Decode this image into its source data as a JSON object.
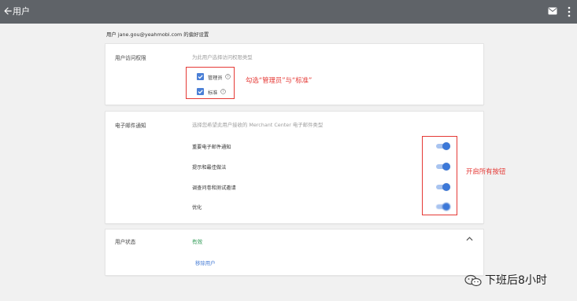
{
  "app_bar": {
    "title": "用户",
    "back_icon": "arrow-back-icon",
    "mail_icon": "mail-icon",
    "more_icon": "more-vert-icon",
    "background": "#5f6368"
  },
  "page_title": "用户 jane.gou@yeahmobi.com 的偏好设置",
  "access": {
    "label": "用户访问权限",
    "description": "为此用户选择访问权限类型",
    "options": [
      {
        "label": "管理员",
        "checked": true
      },
      {
        "label": "标准",
        "checked": true
      }
    ]
  },
  "email": {
    "label": "电子邮件通知",
    "description": "选择您希望此用户接收的 Merchant Center 电子邮件类型",
    "settings": [
      {
        "label": "重要电子邮件通知",
        "enabled": true
      },
      {
        "label": "提示和最佳做法",
        "enabled": true
      },
      {
        "label": "调查问卷和测试邀请",
        "enabled": true
      },
      {
        "label": "优化",
        "enabled": true
      }
    ]
  },
  "status": {
    "label": "用户状态",
    "value": "有效",
    "remove_link": "移除用户"
  },
  "annotations": {
    "checkbox_note": "勾选“管理员”与“标准”",
    "toggle_note": "开启所有按钮",
    "color": "#e53935"
  },
  "watermark": {
    "text": "下班后8小时"
  },
  "colors": {
    "accent": "#4a7fd6",
    "toggle_on": "#3c78d8",
    "status_ok": "#2f9a55"
  }
}
